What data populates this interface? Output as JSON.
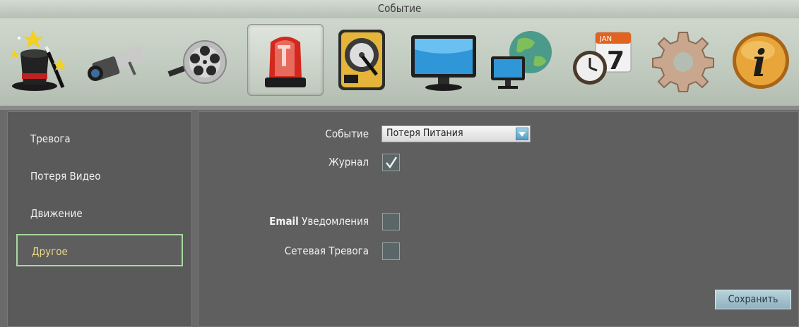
{
  "window": {
    "title": "Событие"
  },
  "toolbar": {
    "items": [
      {
        "icon": "wizard-hat-icon"
      },
      {
        "icon": "camera-icon"
      },
      {
        "icon": "film-reel-icon"
      },
      {
        "icon": "alarm-siren-icon",
        "active": true
      },
      {
        "icon": "hard-drive-icon"
      },
      {
        "icon": "monitor-icon"
      },
      {
        "icon": "network-globe-icon"
      },
      {
        "icon": "clock-calendar-icon",
        "calendar_day": "7",
        "calendar_month": "JAN"
      },
      {
        "icon": "gear-icon"
      },
      {
        "icon": "info-icon",
        "glyph": "i"
      }
    ]
  },
  "sidebar": {
    "items": [
      {
        "label": "Тревога"
      },
      {
        "label": "Потеря Видео"
      },
      {
        "label": "Движение"
      },
      {
        "label": "Другое",
        "selected": true
      }
    ]
  },
  "form": {
    "event_label": "Событие",
    "event_value": "Потеря Питания",
    "log_label": "Журнал",
    "log_checked": true,
    "email_label_bold": "Email",
    "email_label_rest": "Уведомления",
    "email_checked": false,
    "network_alarm_label": "Сетевая Тревога",
    "network_alarm_checked": false,
    "save_label": "Сохранить"
  },
  "colors": {
    "selected_border": "#a9d8a1",
    "selected_text": "#ecd98a",
    "panel_bg": "#5f5f5f"
  }
}
